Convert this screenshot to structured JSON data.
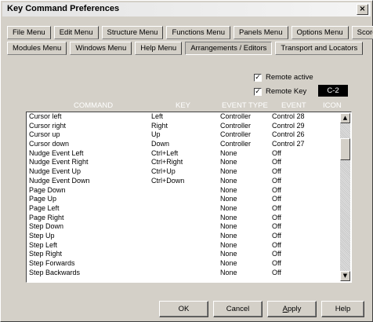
{
  "window": {
    "title": "Key Command Preferences",
    "close_glyph": "×"
  },
  "tabs_row1": [
    "File Menu",
    "Edit Menu",
    "Structure Menu",
    "Functions Menu",
    "Panels Menu",
    "Options Menu",
    "Score"
  ],
  "tabs_row2": [
    "Modules Menu",
    "Windows Menu",
    "Help Menu",
    "Arrangements / Editors",
    "Transport and Locators"
  ],
  "active_tab": "Arrangements / Editors",
  "remote": {
    "active_label": "Remote active",
    "active_checked": "✓",
    "key_label": "Remote Key",
    "key_checked": "✓",
    "key_value": "C-2"
  },
  "columns": {
    "command": "COMMAND",
    "key": "KEY",
    "event_type": "EVENT TYPE",
    "event": "EVENT",
    "icon": "ICON"
  },
  "rows": [
    [
      "Cursor left",
      "Left",
      "Controller",
      "Control 28"
    ],
    [
      "Cursor right",
      "Right",
      "Controller",
      "Control 29"
    ],
    [
      "Cursor up",
      "Up",
      "Controller",
      "Control 26"
    ],
    [
      "Cursor down",
      "Down",
      "Controller",
      "Control 27"
    ],
    [
      "Nudge Event Left",
      "Ctrl+Left",
      "None",
      "Off"
    ],
    [
      "Nudge Event Right",
      "Ctrl+Right",
      "None",
      "Off"
    ],
    [
      "Nudge Event Up",
      "Ctrl+Up",
      "None",
      "Off"
    ],
    [
      "Nudge Event Down",
      "Ctrl+Down",
      "None",
      "Off"
    ],
    [
      "Page Down",
      "",
      "None",
      "Off"
    ],
    [
      "Page Up",
      "",
      "None",
      "Off"
    ],
    [
      "Page Left",
      "",
      "None",
      "Off"
    ],
    [
      "Page Right",
      "",
      "None",
      "Off"
    ],
    [
      "Step Down",
      "",
      "None",
      "Off"
    ],
    [
      "Step Up",
      "",
      "None",
      "Off"
    ],
    [
      "Step Left",
      "",
      "None",
      "Off"
    ],
    [
      "Step Right",
      "",
      "None",
      "Off"
    ],
    [
      "Step Forwards",
      "",
      "None",
      "Off"
    ],
    [
      "Step Backwards",
      "",
      "None",
      "Off"
    ]
  ],
  "scroll": {
    "up": "▲",
    "down": "▼"
  },
  "buttons": {
    "ok": "OK",
    "cancel": "Cancel",
    "apply": "Apply",
    "help": "Help"
  }
}
